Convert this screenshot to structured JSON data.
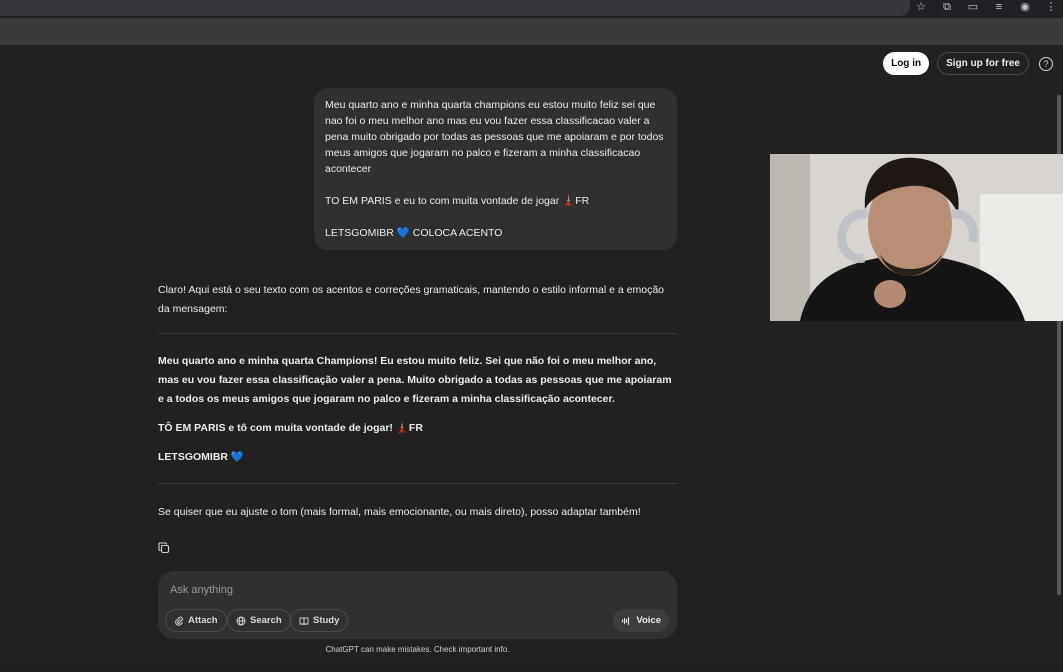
{
  "header": {
    "login_label": "Log in",
    "signup_label": "Sign up for free",
    "help_glyph": "?"
  },
  "user_message": {
    "paragraph_1": "Meu quarto ano e minha quarta champions eu estou muito feliz sei que nao foi o meu melhor ano mas eu vou fazer essa classificacao valer a pena muito obrigado por todas as pessoas que me apoiaram e por todos meus amigos que jogaram no palco e fizeram a minha classificacao acontecer",
    "paragraph_2": "TO EM PARIS e eu to com muita vontade de jogar 🗼FR",
    "paragraph_3": "LETSGOMIBR 💙 COLOCA ACENTO"
  },
  "assistant_message": {
    "intro": "Claro! Aqui está o seu texto com os acentos e correções gramaticais, mantendo o estilo informal e a emoção da mensagem:",
    "corrected_1": "Meu quarto ano e minha quarta Champions! Eu estou muito feliz. Sei que não foi o meu melhor ano, mas eu vou fazer essa classificação valer a pena. Muito obrigado a todas as pessoas que me apoiaram e a todos os meus amigos que jogaram no palco e fizeram a minha classificação acontecer.",
    "corrected_2": "TÔ EM PARIS e tô com muita vontade de jogar! 🗼FR",
    "corrected_3": "LETSGOMIBR 💙",
    "outro": "Se quiser que eu ajuste o tom (mais formal, mais emocionante, ou mais direto), posso adaptar também!"
  },
  "composer": {
    "placeholder": "Ask anything",
    "attach_label": "Attach",
    "search_label": "Search",
    "study_label": "Study",
    "voice_label": "Voice"
  },
  "footer": {
    "disclaimer": "ChatGPT can make mistakes. Check important info."
  },
  "colors": {
    "background": "#212121",
    "bubble": "#303030",
    "text": "#ececec"
  }
}
